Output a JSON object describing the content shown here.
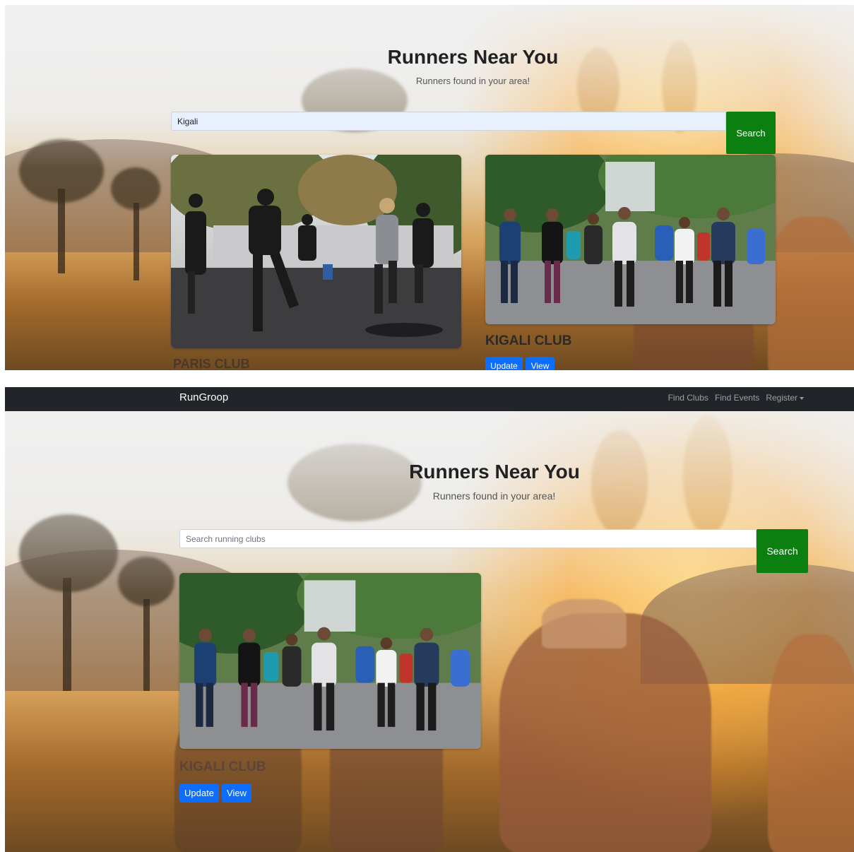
{
  "screenshot_top": {
    "hero": {
      "title": "Runners Near You",
      "subtitle": "Runners found in your area!"
    },
    "search": {
      "value": "Kigali",
      "button_label": "Search"
    },
    "cards": [
      {
        "title": "PARIS CLUB",
        "image": "group-running-workout-photo"
      },
      {
        "title": "KIGALI CLUB",
        "image": "group-walking-crowd-photo",
        "update_label": "Update",
        "view_label": "View"
      }
    ]
  },
  "screenshot_bottom": {
    "navbar": {
      "brand": "RunGroop",
      "links": [
        "Find Clubs",
        "Find Events",
        "Register"
      ]
    },
    "hero": {
      "title": "Runners Near You",
      "subtitle": "Runners found in your area!"
    },
    "search": {
      "placeholder": "Search running clubs",
      "button_label": "Search"
    },
    "cards": [
      {
        "title": "KIGALI CLUB",
        "image": "group-walking-crowd-photo",
        "update_label": "Update",
        "view_label": "View"
      }
    ]
  },
  "colors": {
    "navbar": "#212529",
    "search_button": "#0b7f10",
    "primary_button": "#0d6efd",
    "autofill_input": "#e8f0fe"
  },
  "icons": [
    "dropdown-caret-icon"
  ]
}
